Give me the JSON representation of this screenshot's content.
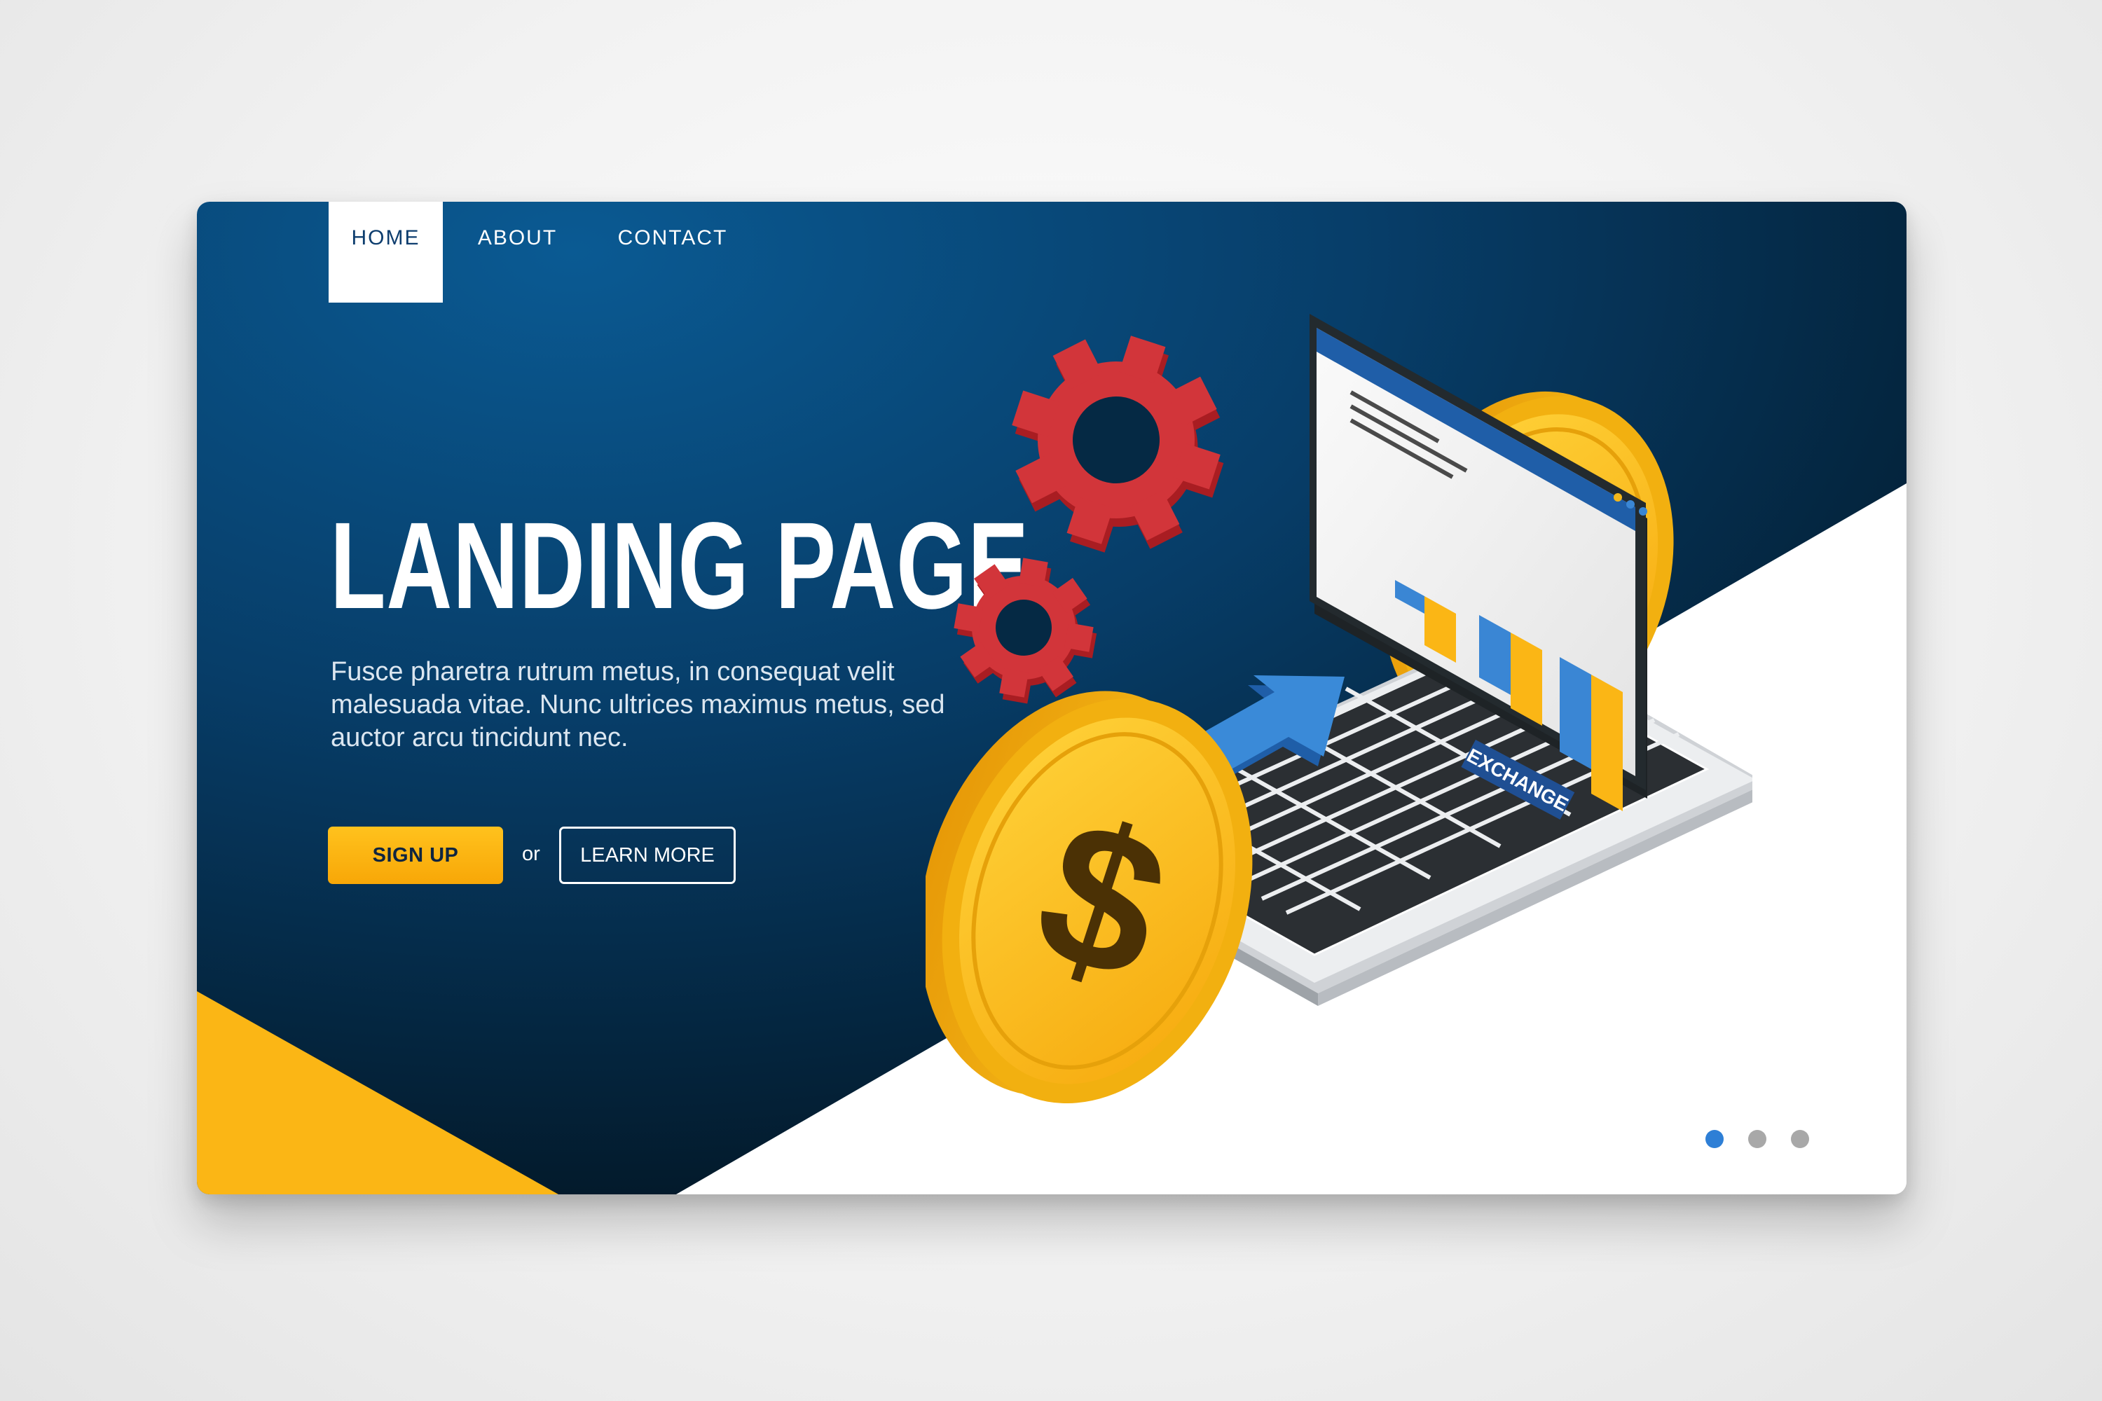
{
  "nav": {
    "items": [
      {
        "label": "HOME",
        "active": true
      },
      {
        "label": "ABOUT",
        "active": false
      },
      {
        "label": "CONTACT",
        "active": false
      }
    ]
  },
  "hero": {
    "title": "LANDING PAGE",
    "description": "Fusce pharetra rutrum metus, in consequat velit malesuada vitae. Nunc ultrices maximus metus, sed auctor arcu tincidunt nec.",
    "signup_label": "SIGN UP",
    "or_label": "or",
    "learn_more_label": "LEARN MORE"
  },
  "illustration": {
    "screen_badge": "EXCHANGE",
    "icons": [
      "gear-icon",
      "laptop-icon",
      "dollar-coin-icon",
      "bitcoin-coin-icon",
      "trend-arrow-icon",
      "bar-chart-icon"
    ]
  },
  "carousel": {
    "slides": 3,
    "active_index": 0
  },
  "colors": {
    "navy": "#0a3a66",
    "navy_dark": "#031826",
    "accent_yellow": "#fbb615",
    "gear_red": "#c8262a",
    "dot_active": "#2e7fd6",
    "dot_inactive": "#a8a8a8"
  }
}
